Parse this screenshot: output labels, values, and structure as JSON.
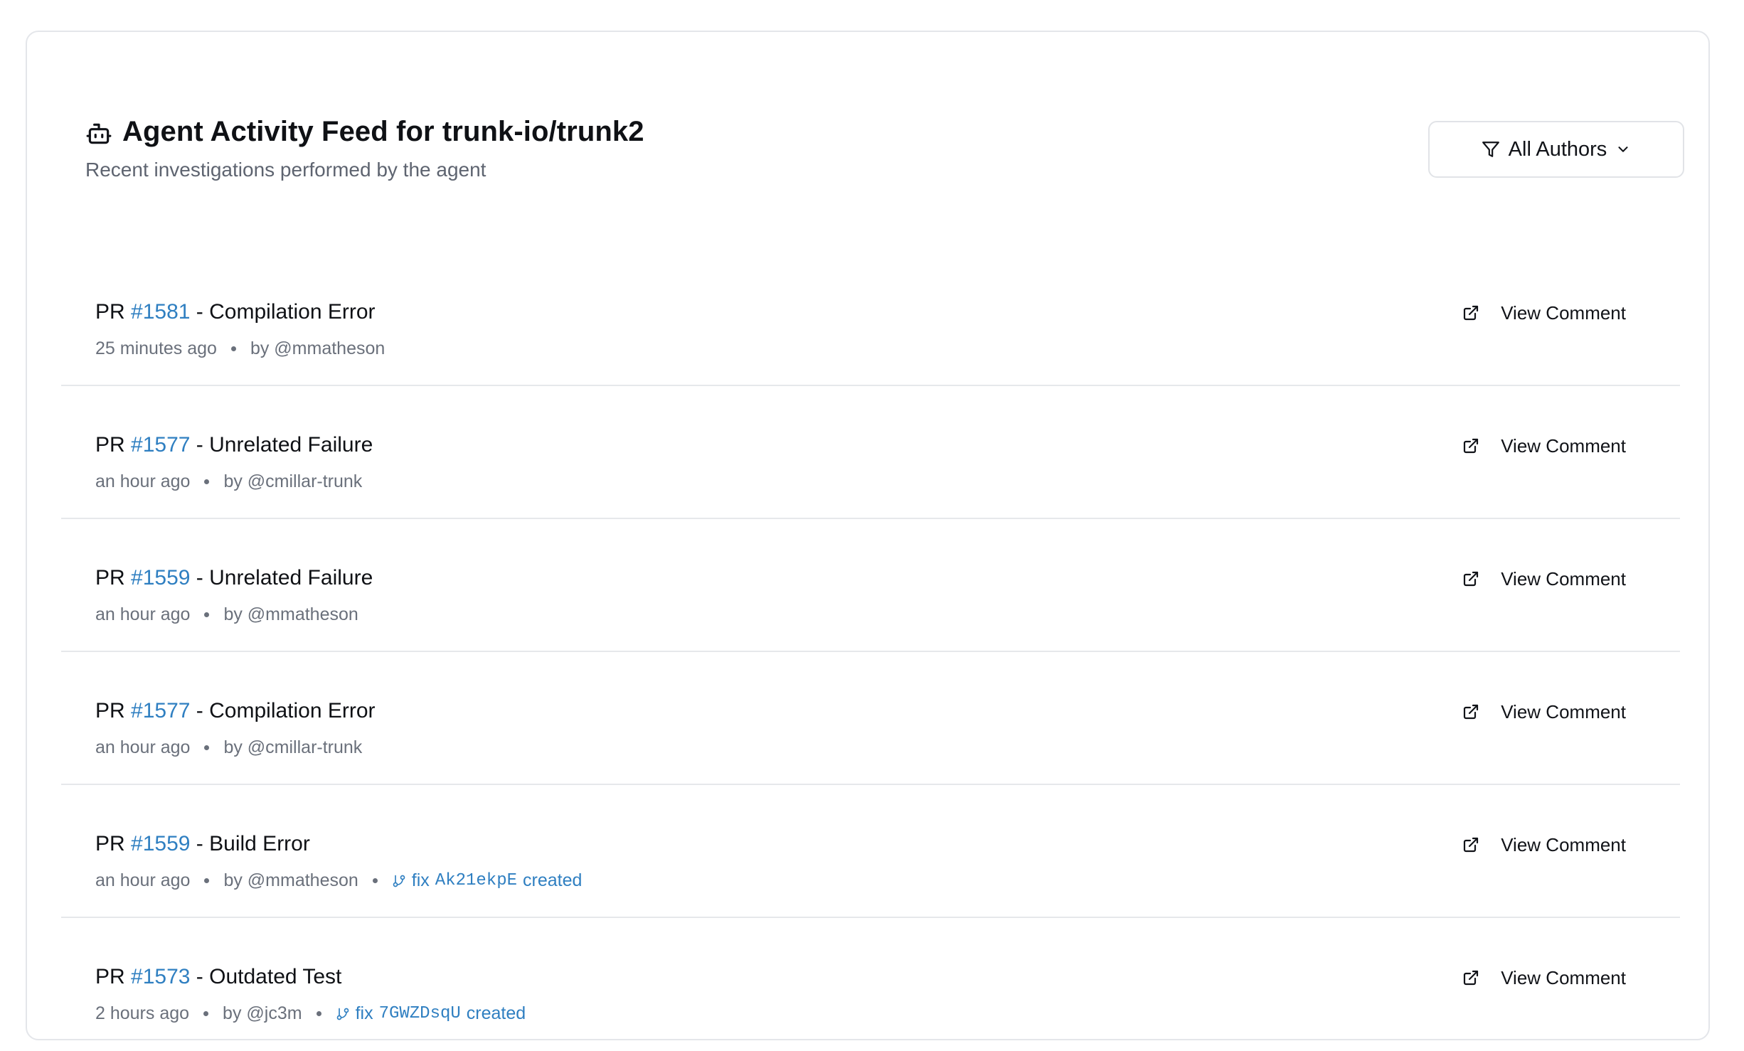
{
  "header": {
    "title": "Agent Activity Feed for trunk-io/trunk2",
    "subtitle": "Recent investigations performed by the agent",
    "robot_icon": "robot-icon"
  },
  "filter": {
    "label": "All Authors",
    "icon": "filter-icon",
    "chevron": "chevron-down-icon"
  },
  "feed": {
    "items": [
      {
        "pr_prefix": "PR",
        "pr_number": "#1581",
        "separator": " - ",
        "category": "Compilation Error",
        "time": "25 minutes ago",
        "author": "by @mmatheson",
        "fix": null,
        "action_label": "View Comment"
      },
      {
        "pr_prefix": "PR",
        "pr_number": "#1577",
        "separator": " - ",
        "category": "Unrelated Failure",
        "time": "an hour ago",
        "author": "by @cmillar-trunk",
        "fix": null,
        "action_label": "View Comment"
      },
      {
        "pr_prefix": "PR",
        "pr_number": "#1559",
        "separator": " - ",
        "category": "Unrelated Failure",
        "time": "an hour ago",
        "author": "by @mmatheson",
        "fix": null,
        "action_label": "View Comment"
      },
      {
        "pr_prefix": "PR",
        "pr_number": "#1577",
        "separator": " - ",
        "category": "Compilation Error",
        "time": "an hour ago",
        "author": "by @cmillar-trunk",
        "fix": null,
        "action_label": "View Comment"
      },
      {
        "pr_prefix": "PR",
        "pr_number": "#1559",
        "separator": " - ",
        "category": "Build Error",
        "time": "an hour ago",
        "author": "by @mmatheson",
        "fix": {
          "prefix": "fix",
          "id": "Ak21ekpE",
          "suffix": "created"
        },
        "action_label": "View Comment"
      },
      {
        "pr_prefix": "PR",
        "pr_number": "#1573",
        "separator": " - ",
        "category": "Outdated Test",
        "time": "2 hours ago",
        "author": "by @jc3m",
        "fix": {
          "prefix": "fix",
          "id": "7GWZDsqU",
          "suffix": "created"
        },
        "action_label": "View Comment"
      }
    ]
  },
  "colors": {
    "link": "#2f7fc1",
    "muted": "#6a707b",
    "border": "#e4e6ea",
    "text": "#0f1115"
  }
}
